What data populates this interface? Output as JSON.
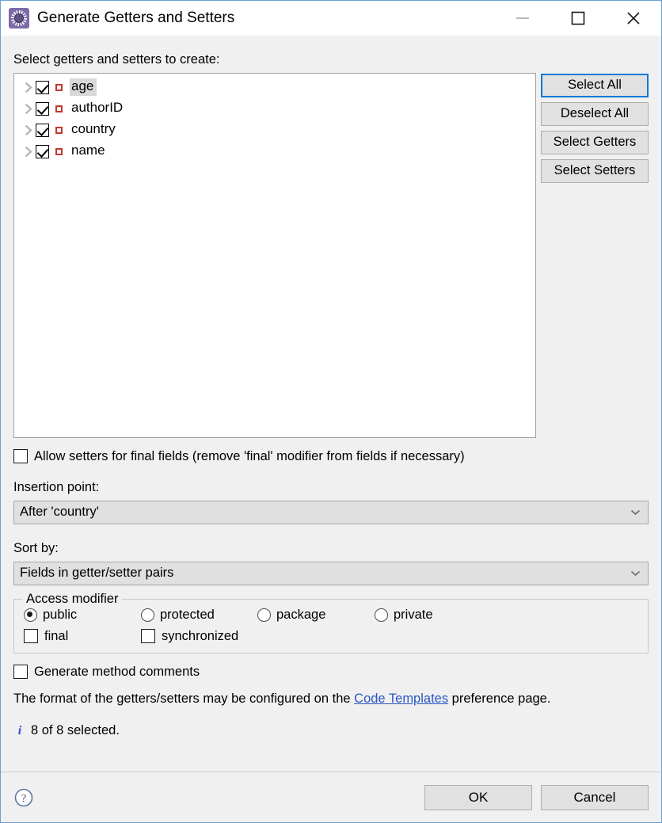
{
  "window": {
    "title": "Generate Getters and Setters",
    "icon": "gear-icon",
    "controls": {
      "minimize": "minimize-icon",
      "maximize": "maximize-icon",
      "close": "close-icon"
    }
  },
  "list_section": {
    "label": "Select getters and setters to create:",
    "fields": [
      {
        "name": "age",
        "checked": true,
        "selected": true,
        "icon": "private-field-icon",
        "expandable": true
      },
      {
        "name": "authorID",
        "checked": true,
        "selected": false,
        "icon": "private-field-icon",
        "expandable": true
      },
      {
        "name": "country",
        "checked": true,
        "selected": false,
        "icon": "private-field-icon",
        "expandable": true
      },
      {
        "name": "name",
        "checked": true,
        "selected": false,
        "icon": "private-field-icon",
        "expandable": true
      }
    ]
  },
  "side_buttons": [
    {
      "label": "Select All",
      "focused": true
    },
    {
      "label": "Deselect All",
      "focused": false
    },
    {
      "label": "Select Getters",
      "focused": false
    },
    {
      "label": "Select Setters",
      "focused": false
    }
  ],
  "allow_final": {
    "label": "Allow setters for final fields (remove 'final' modifier from fields if necessary)",
    "checked": false
  },
  "insertion_point": {
    "label": "Insertion point:",
    "value": "After 'country'",
    "caret": "chevron-down-icon"
  },
  "sort_by": {
    "label": "Sort by:",
    "value": "Fields in getter/setter pairs",
    "caret": "chevron-down-icon"
  },
  "access_modifier": {
    "title": "Access modifier",
    "radios": [
      {
        "label": "public",
        "selected": true
      },
      {
        "label": "protected",
        "selected": false
      },
      {
        "label": "package",
        "selected": false
      },
      {
        "label": "private",
        "selected": false
      }
    ],
    "modifiers": [
      {
        "label": "final",
        "checked": false
      },
      {
        "label": "synchronized",
        "checked": false
      }
    ]
  },
  "generate_comments": {
    "label": "Generate method comments",
    "checked": false
  },
  "hint": {
    "before": "The format of the getters/setters may be configured on the ",
    "link": "Code Templates",
    "after": " preference page."
  },
  "status": {
    "icon": "info-icon",
    "text": "8 of 8 selected."
  },
  "footer": {
    "help": "help-icon",
    "ok": "OK",
    "cancel": "Cancel"
  },
  "colors": {
    "accent": "#0078d7",
    "link": "#2a56c6",
    "dialog_bg": "#f0f0f0",
    "list_bg": "#ffffff",
    "field_icon": "#c0392b",
    "title_icon": "#7d6ba8"
  }
}
